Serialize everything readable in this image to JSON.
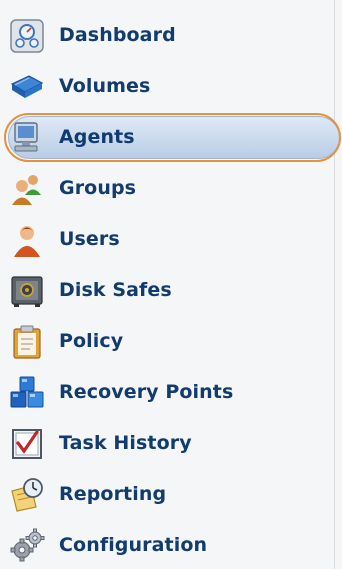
{
  "sidebar": {
    "items": [
      {
        "label": "Dashboard",
        "icon": "dashboard-icon"
      },
      {
        "label": "Volumes",
        "icon": "volumes-icon"
      },
      {
        "label": "Agents",
        "icon": "agents-icon",
        "selected": true
      },
      {
        "label": "Groups",
        "icon": "groups-icon"
      },
      {
        "label": "Users",
        "icon": "users-icon"
      },
      {
        "label": "Disk Safes",
        "icon": "disk-safes-icon"
      },
      {
        "label": "Policy",
        "icon": "policy-icon"
      },
      {
        "label": "Recovery Points",
        "icon": "recovery-points-icon"
      },
      {
        "label": "Task History",
        "icon": "task-history-icon"
      },
      {
        "label": "Reporting",
        "icon": "reporting-icon"
      },
      {
        "label": "Configuration",
        "icon": "configuration-icon"
      }
    ]
  },
  "colors": {
    "label_text": "#123b6e",
    "selection_fill": "#c7d8ec",
    "selection_ring": "#e8903a"
  }
}
